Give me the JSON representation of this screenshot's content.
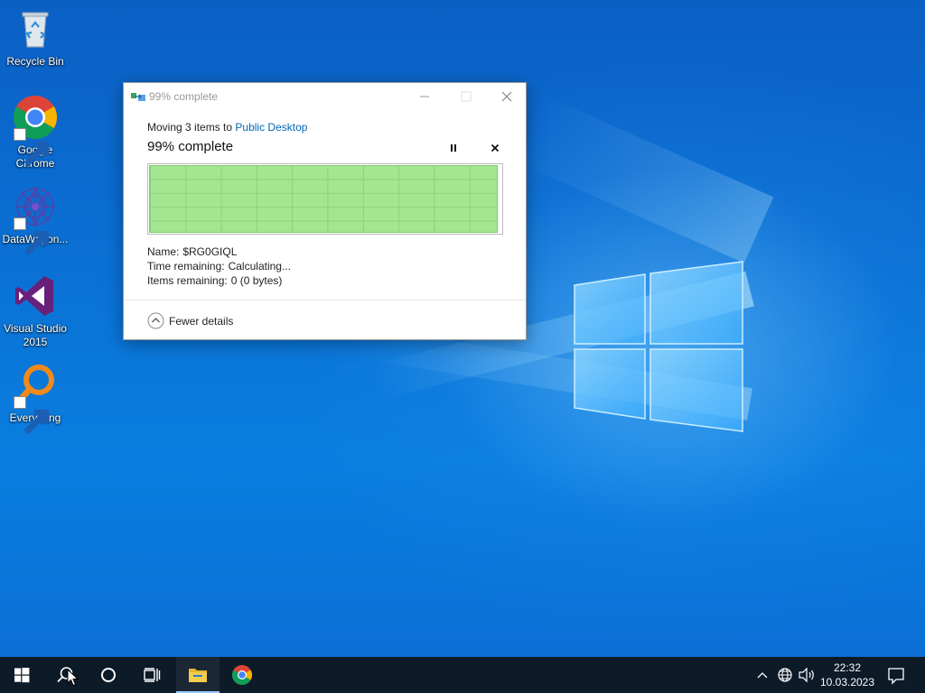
{
  "desktop": {
    "icons": [
      {
        "label": "Recycle Bin",
        "icon": "recycle-bin-icon"
      },
      {
        "label": "Google Chrome",
        "icon": "chrome-icon"
      },
      {
        "label": "DataWagon...",
        "icon": "datawagon-icon"
      },
      {
        "label": "Visual Studio 2015",
        "icon": "visual-studio-icon"
      },
      {
        "label": "Everything",
        "icon": "everything-search-icon"
      }
    ]
  },
  "dialog": {
    "title": "99% complete",
    "moving_prefix": "Moving 3 items to",
    "destination": "Public Desktop",
    "status": "99% complete",
    "progress": 0.99,
    "progress_color": "#a3e591",
    "details": {
      "name_label": "Name:",
      "name_value": "$RG0GIQL",
      "time_label": "Time remaining:",
      "time_value": "Calculating...",
      "items_label": "Items remaining:",
      "items_value": "0 (0 bytes)"
    },
    "fewer_details": "Fewer details"
  },
  "taskbar": {
    "items": [
      "start-icon",
      "search-icon",
      "cortana-icon",
      "task-view-icon",
      "file-explorer-icon",
      "chrome-icon"
    ],
    "tray": [
      "chevron-up-icon",
      "network-globe-icon",
      "volume-icon",
      "notification-icon"
    ],
    "time": "22:32",
    "date": "10.03.2023",
    "background": "#0d1a28"
  },
  "colors": {
    "link": "#0066b4",
    "desktop_blue": "#0a73d6"
  }
}
